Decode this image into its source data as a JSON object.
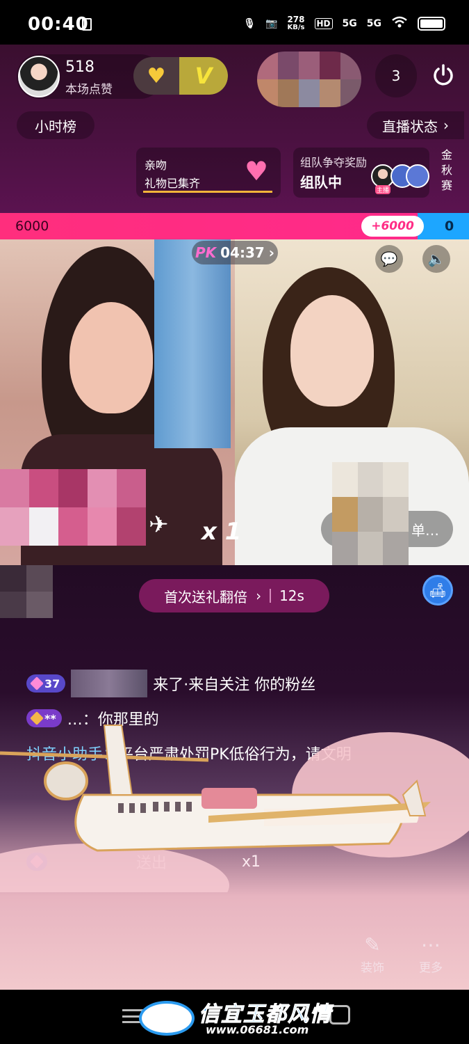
{
  "status_bar": {
    "time": "00:40",
    "net_speed": "278",
    "net_unit": "KB/s",
    "hd": "HD",
    "sig1": "5G",
    "sig2": "5G"
  },
  "host": {
    "likes": "518",
    "likes_label": "本场点赞"
  },
  "top_right": {
    "viewer_count": "3"
  },
  "hour_rank_label": "小时榜",
  "live_status_label": "直播状态",
  "kiss_card": {
    "title": "亲吻",
    "subtitle": "礼物已集齐"
  },
  "team_card": {
    "title": "组队争夺奖励",
    "status": "组队中",
    "host_tag": "主播"
  },
  "gold_event": "金秋赛",
  "pk": {
    "left_score": "6000",
    "right_score": "0",
    "bonus": "+6000",
    "timer_prefix": "PK",
    "timer": "04:37",
    "left_fraction": 0.89
  },
  "gift": {
    "multiplier": "x 1"
  },
  "right_panel_label": "单…",
  "double_gift": {
    "label": "首次送礼翻倍",
    "countdown": "12s"
  },
  "chat": {
    "line1_level": "37",
    "line1_text": "来了·来自关注 你的粉丝",
    "line2_level": "**",
    "line2_text": "…：你那里的",
    "assistant_name": "抖音小助手：",
    "assistant_text": "平台严肃处罚PK低俗行为，请文明",
    "line4_text": "送出",
    "line4_count": "x1"
  },
  "tools": {
    "decor_label": "装饰",
    "more_label": "更多"
  },
  "watermark": {
    "title": "信宜玉都风情",
    "url": "www.06681.com"
  },
  "colors": {
    "pk_pink": "#ff2e7d",
    "pk_blue": "#1da6ff",
    "accent_blue": "#2b9bf0"
  }
}
